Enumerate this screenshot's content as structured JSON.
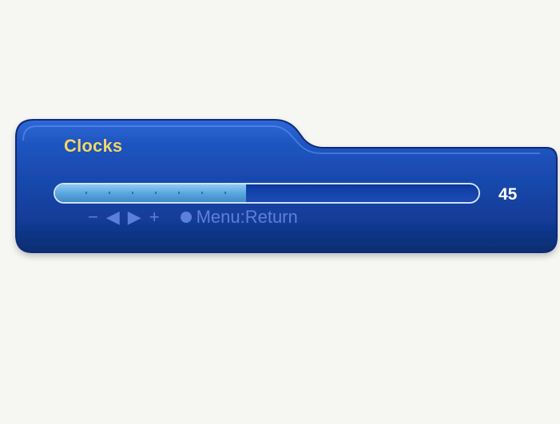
{
  "title": "Clocks",
  "value": "45",
  "level_percent": 45,
  "controls": {
    "minus": "−",
    "left": "◀",
    "right": "▶",
    "plus": "+",
    "menu": "Menu:Return"
  },
  "colors": {
    "background": "#f6f6f3",
    "panel": "#1543a8",
    "title": "#f1d76a",
    "text": "#ffffff",
    "controls": "#5b80da"
  }
}
